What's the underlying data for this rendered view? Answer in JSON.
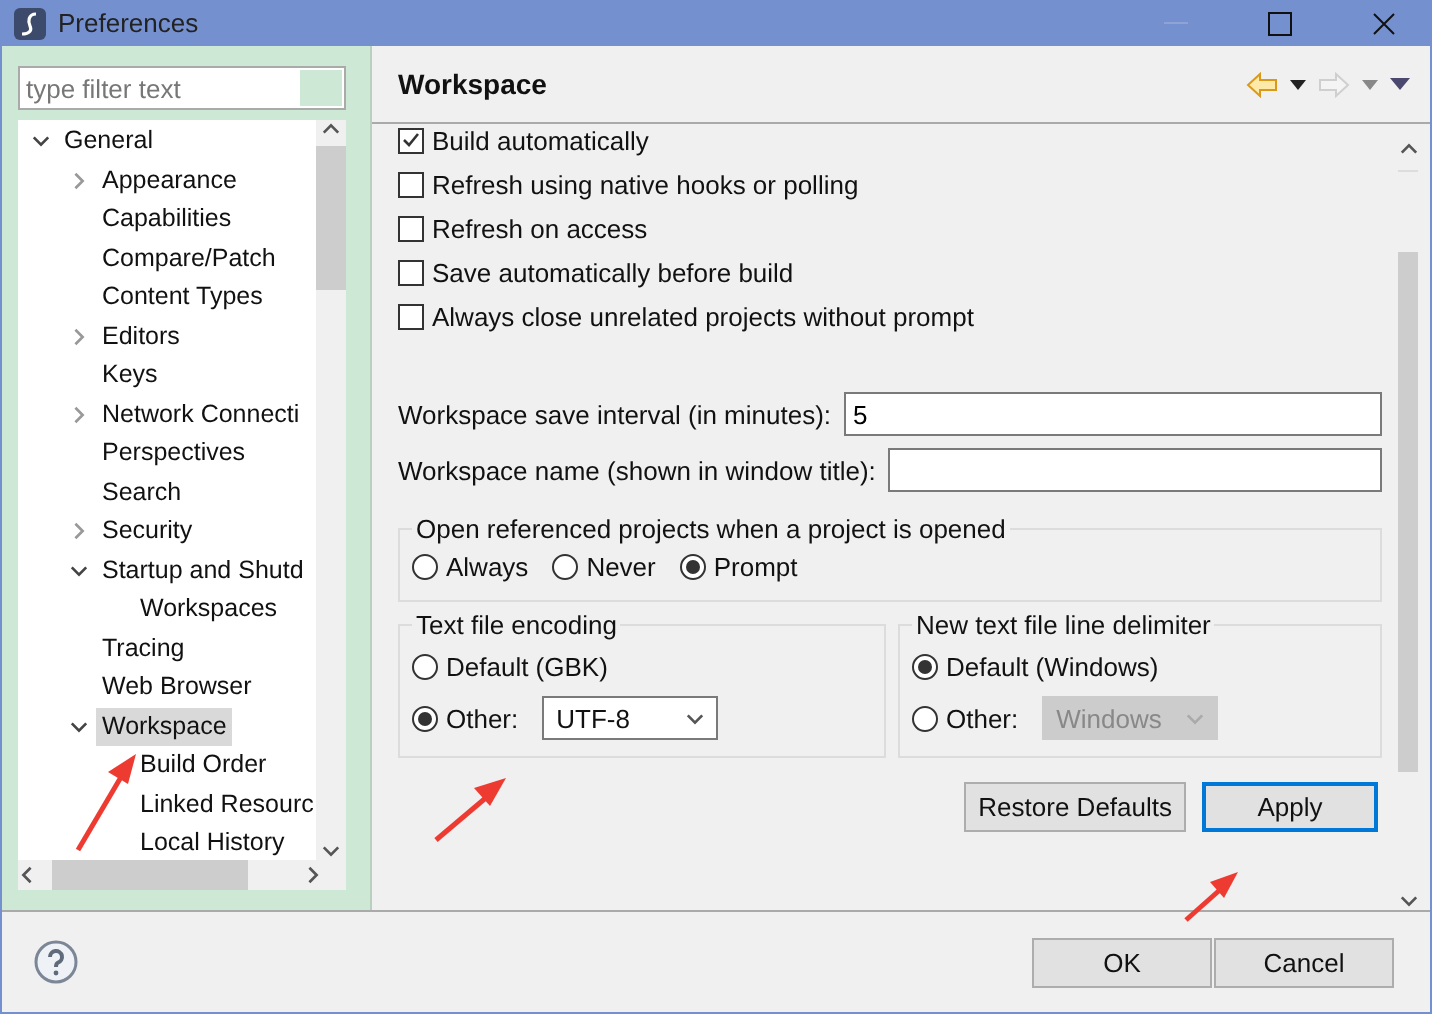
{
  "window": {
    "title": "Preferences"
  },
  "filter": {
    "placeholder": "type filter text"
  },
  "tree": [
    {
      "label": "General",
      "expanded": true,
      "selected": false,
      "children": [
        {
          "label": "Appearance",
          "expanded": false,
          "selected": false
        },
        {
          "label": "Capabilities",
          "selected": false
        },
        {
          "label": "Compare/Patch",
          "selected": false
        },
        {
          "label": "Content Types",
          "selected": false
        },
        {
          "label": "Editors",
          "expanded": false,
          "selected": false
        },
        {
          "label": "Keys",
          "selected": false
        },
        {
          "label": "Network Connecti",
          "expanded": false,
          "selected": false
        },
        {
          "label": "Perspectives",
          "selected": false
        },
        {
          "label": "Search",
          "selected": false
        },
        {
          "label": "Security",
          "expanded": false,
          "selected": false
        },
        {
          "label": "Startup and Shutd",
          "expanded": true,
          "selected": false,
          "children": [
            {
              "label": "Workspaces",
              "selected": false
            }
          ]
        },
        {
          "label": "Tracing",
          "selected": false
        },
        {
          "label": "Web Browser",
          "selected": false
        },
        {
          "label": "Workspace",
          "expanded": true,
          "selected": true,
          "children": [
            {
              "label": "Build Order",
              "selected": false
            },
            {
              "label": "Linked Resourc",
              "selected": false
            },
            {
              "label": "Local History",
              "selected": false
            }
          ]
        }
      ]
    }
  ],
  "page": {
    "title": "Workspace"
  },
  "options": [
    {
      "label": "Build automatically",
      "checked": true
    },
    {
      "label": "Refresh using native hooks or polling",
      "checked": false
    },
    {
      "label": "Refresh on access",
      "checked": false
    },
    {
      "label": "Save automatically before build",
      "checked": false
    },
    {
      "label": "Always close unrelated projects without prompt",
      "checked": false
    }
  ],
  "fields": [
    {
      "label": "Workspace save interval (in minutes):",
      "value": "5"
    },
    {
      "label": "Workspace name (shown in window title):"
    }
  ],
  "open_referenced": {
    "title": "Open referenced projects when a project is opened",
    "options": [
      {
        "label": "Always",
        "selected": false
      },
      {
        "label": "Never",
        "selected": false
      },
      {
        "label": "Prompt",
        "selected": true
      }
    ]
  },
  "encoding": {
    "title": "Text file encoding",
    "options": [
      {
        "kind": "plain",
        "label": "Default (GBK)",
        "selected": false
      },
      {
        "kind": "select",
        "label": "Other:",
        "selected": true,
        "value": "UTF-8",
        "disabled": false
      }
    ]
  },
  "delimiter": {
    "title": "New text file line delimiter",
    "options": [
      {
        "kind": "plain",
        "label": "Default (Windows)",
        "selected": true
      },
      {
        "kind": "select",
        "label": "Other:",
        "selected": false,
        "value": "Windows",
        "disabled": true
      }
    ]
  },
  "page_buttons": [
    {
      "label": "Restore Defaults",
      "focused": false
    },
    {
      "label": "Apply",
      "focused": true
    }
  ],
  "dialog_buttons": [
    {
      "label": "OK",
      "focused": false
    },
    {
      "label": "Cancel",
      "focused": false
    }
  ]
}
